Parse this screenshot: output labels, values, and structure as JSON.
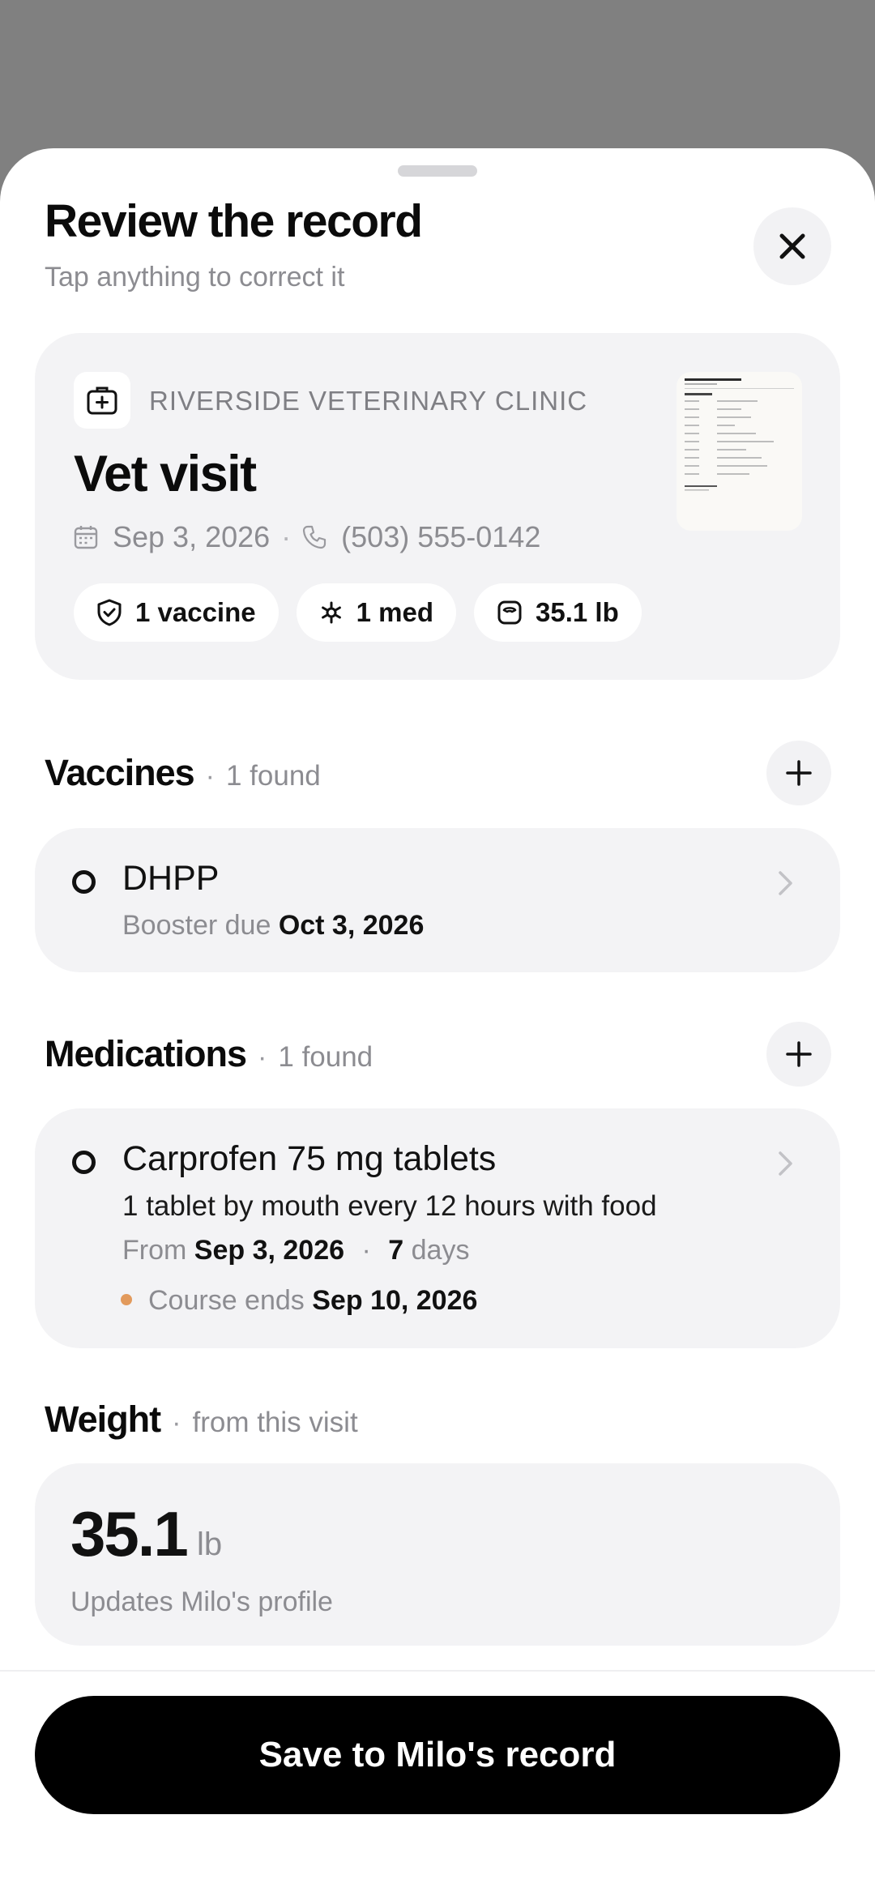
{
  "header": {
    "title": "Review the record",
    "subtitle": "Tap anything to correct it"
  },
  "summary": {
    "clinic": "RIVERSIDE VETERINARY CLINIC",
    "visit_title": "Vet visit",
    "date": "Sep 3, 2026",
    "separator": "·",
    "phone": "(503) 555-0142",
    "chips": [
      {
        "icon": "shield-check-icon",
        "label": "1 vaccine"
      },
      {
        "icon": "pill-icon",
        "label": "1 med"
      },
      {
        "icon": "scale-icon",
        "label": "35.1 lb"
      }
    ]
  },
  "vaccines": {
    "title": "Vaccines",
    "dot": "·",
    "count": "1 found",
    "items": [
      {
        "name": "DHPP",
        "due_label": "Booster due",
        "due_date": "Oct 3, 2026"
      }
    ]
  },
  "medications": {
    "title": "Medications",
    "dot": "·",
    "count": "1 found",
    "items": [
      {
        "name": "Carprofen 75 mg tablets",
        "dosage": "1 tablet by mouth every 12 hours with food",
        "from_label": "From",
        "from_date": "Sep 3, 2026",
        "dot": "·",
        "duration_num": "7",
        "duration_unit": "days",
        "ends_label": "Course ends",
        "ends_date": "Sep 10, 2026",
        "ends_dot_color": "#e29a5c"
      }
    ]
  },
  "weight": {
    "title": "Weight",
    "dot": "·",
    "source": "from this visit",
    "value": "35.1",
    "unit": "lb",
    "note": "Updates Milo's profile"
  },
  "footer": {
    "save_label": "Save to Milo's record"
  },
  "colors": {
    "backdrop": "#808080",
    "card": "#f3f3f5",
    "accent_dot": "#e29a5c",
    "primary_button": "#000000"
  }
}
